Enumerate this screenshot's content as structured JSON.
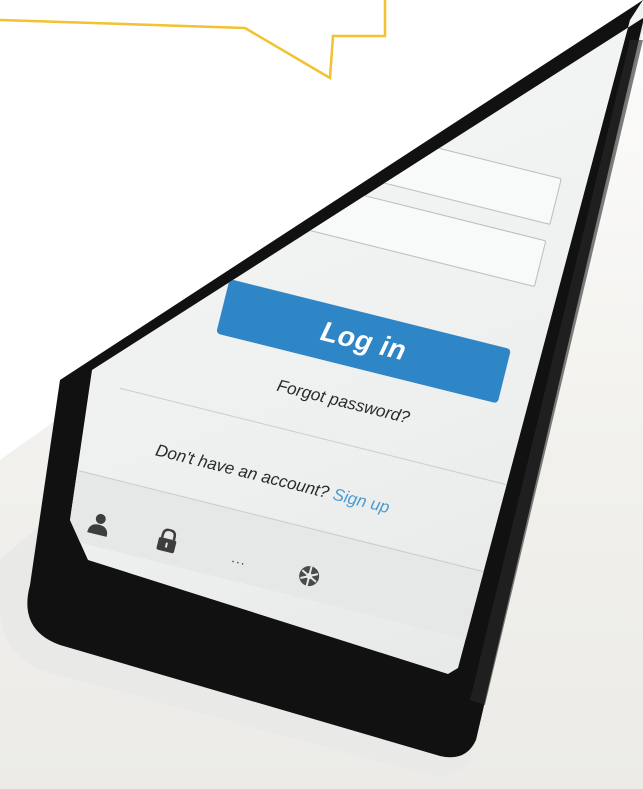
{
  "login_form": {
    "username_value": "",
    "password_value": "",
    "login_label": "Log in",
    "forgot_label": "Forgot password?",
    "signup_prompt": "Don't have an account?",
    "signup_label": "Sign up"
  },
  "tabbar": {
    "items": [
      {
        "icon": "user-icon"
      },
      {
        "icon": "lock-icon"
      },
      {
        "icon": "more-icon",
        "label": "..."
      },
      {
        "icon": "settings-icon"
      }
    ]
  },
  "colors": {
    "accent": "#2f86c6",
    "link": "#4a9bd0",
    "callout": "#f2c230",
    "phone": "#111111"
  }
}
